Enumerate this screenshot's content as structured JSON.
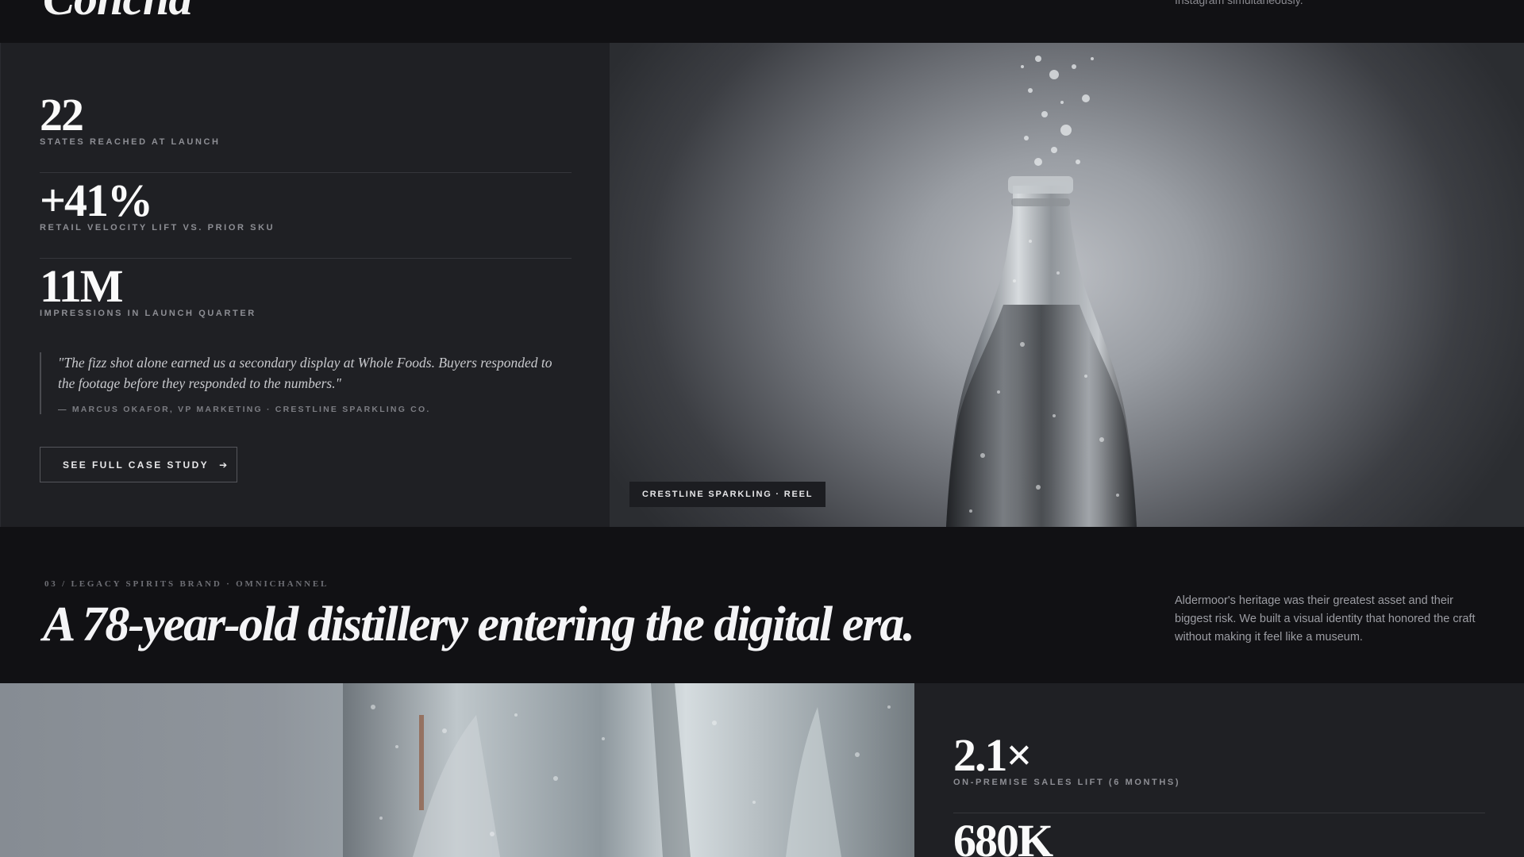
{
  "prev_case": {
    "title_fragment": "Concha",
    "desc_fragment": "Instagram simultaneously."
  },
  "case2": {
    "stats": [
      {
        "value": "22",
        "label": "STATES REACHED AT LAUNCH"
      },
      {
        "value": "+41%",
        "label": "RETAIL VELOCITY LIFT VS. PRIOR SKU"
      },
      {
        "value": "11M",
        "label": "IMPRESSIONS IN LAUNCH QUARTER"
      }
    ],
    "quote": "\"The fizz shot alone earned us a secondary display at Whole Foods. Buyers responded to the footage before they responded to the numbers.\"",
    "cite": "— MARCUS OKAFOR, VP MARKETING · CRESTLINE SPARKLING CO.",
    "cta_label": "SEE FULL CASE STUDY",
    "cta_icon": "arrow-right-icon",
    "image_tag": "CRESTLINE SPARKLING · REEL"
  },
  "case3": {
    "eyebrow": "03 / LEGACY SPIRITS BRAND · OMNICHANNEL",
    "headline": "A 78-year-old distillery entering the digital era.",
    "description": "Aldermoor's heritage was their greatest asset and their biggest risk. We built a visual identity that honored the craft without making it feel like a museum.",
    "stats": [
      {
        "value": "2.1×",
        "label": "ON-PREMISE SALES LIFT (6 MONTHS)"
      },
      {
        "value": "680K",
        "label": ""
      }
    ]
  }
}
